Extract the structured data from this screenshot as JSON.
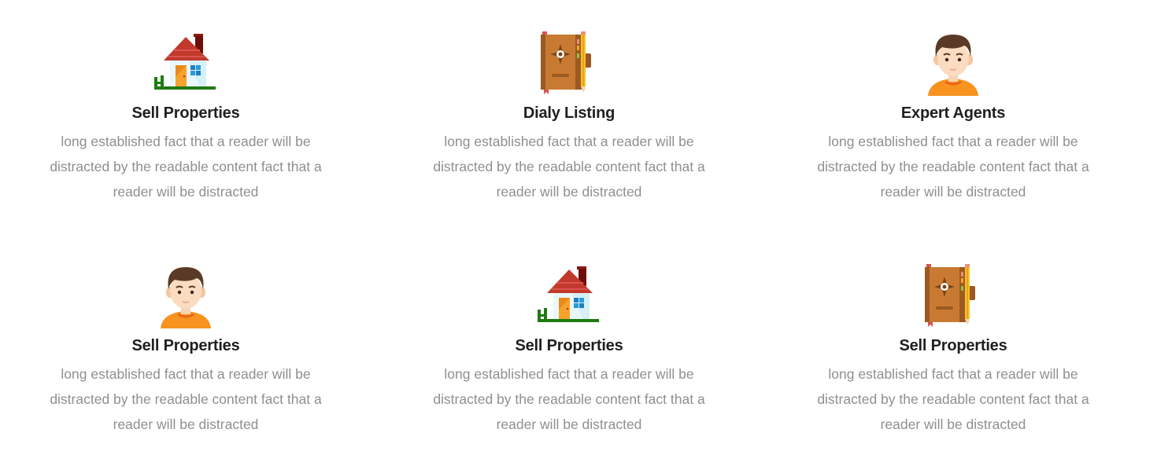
{
  "features": [
    {
      "icon": "house-icon",
      "title": "Sell Properties",
      "description": "long established fact that a reader will be distracted by the readable content fact that a reader will be distracted"
    },
    {
      "icon": "notebook-icon",
      "title": "Dialy Listing",
      "description": "long established fact that a reader will be distracted by the readable content fact that a reader will be distracted"
    },
    {
      "icon": "agent-avatar-icon",
      "title": "Expert Agents",
      "description": "long established fact that a reader will be distracted by the readable content fact that a reader will be distracted"
    },
    {
      "icon": "agent-avatar-icon",
      "title": "Sell Properties",
      "description": "long established fact that a reader will be distracted by the readable content fact that a reader will be distracted"
    },
    {
      "icon": "house-icon",
      "title": "Sell Properties",
      "description": "long established fact that a reader will be distracted by the readable content fact that a reader will be distracted"
    },
    {
      "icon": "notebook-icon",
      "title": "Sell Properties",
      "description": "long established fact that a reader will be distracted by the readable content fact that a reader will be distracted"
    }
  ]
}
